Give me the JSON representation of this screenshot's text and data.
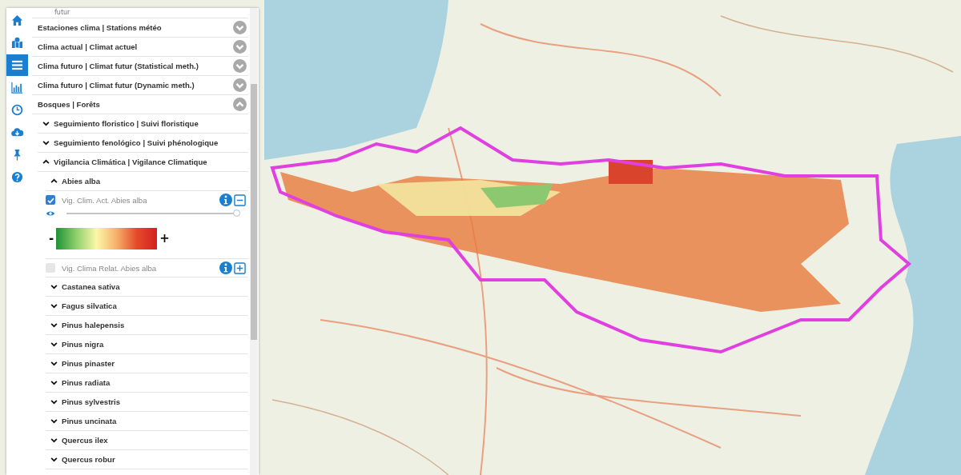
{
  "sidebar": {
    "items": [
      {
        "kind": "home",
        "selected": false
      },
      {
        "kind": "map",
        "selected": false
      },
      {
        "kind": "layers",
        "selected": true
      },
      {
        "kind": "chart",
        "selected": false
      },
      {
        "kind": "clock",
        "selected": false
      },
      {
        "kind": "download",
        "selected": false
      },
      {
        "kind": "pin",
        "selected": false
      },
      {
        "kind": "help",
        "selected": false
      }
    ]
  },
  "layer_panel": {
    "partial_heading": "futur",
    "groups": [
      {
        "label": "Estaciones clima | Stations météo",
        "expanded": false
      },
      {
        "label": "Clima actual | Climat actuel",
        "expanded": false
      },
      {
        "label": "Clima futuro | Climat futur (Statistical meth.)",
        "expanded": false
      },
      {
        "label": "Clima futuro | Climat futur (Dynamic meth.)",
        "expanded": false
      },
      {
        "label": "Bosques | Forêts",
        "expanded": true,
        "children": [
          {
            "label": "Seguimiento floristico | Suivi floristique",
            "expanded": false
          },
          {
            "label": "Seguimiento fenológico | Suivi phénologique",
            "expanded": false
          },
          {
            "label": "Vigilancia Climática | Vigilance Climatique",
            "expanded": true,
            "children": [
              {
                "label": "Abies alba",
                "expanded": true,
                "layers": [
                  {
                    "label": "Vig. Clim. Act. Abies alba",
                    "checked": true,
                    "legend_shown": true,
                    "level": 1,
                    "legend_min": "-",
                    "legend_max": "+"
                  },
                  {
                    "label": "Vig. Clima Relat. Abies alba",
                    "checked": false,
                    "legend_shown": false
                  }
                ]
              },
              {
                "label": "Castanea sativa",
                "expanded": false
              },
              {
                "label": "Fagus silvatica",
                "expanded": false
              },
              {
                "label": "Pinus halepensis",
                "expanded": false
              },
              {
                "label": "Pinus nigra",
                "expanded": false
              },
              {
                "label": "Pinus pinaster",
                "expanded": false
              },
              {
                "label": "Pinus radiata",
                "expanded": false
              },
              {
                "label": "Pinus sylvestris",
                "expanded": false
              },
              {
                "label": "Pinus uncinata",
                "expanded": false
              },
              {
                "label": "Quercus ilex",
                "expanded": false
              },
              {
                "label": "Quercus robur",
                "expanded": false
              }
            ]
          }
        ]
      }
    ]
  }
}
